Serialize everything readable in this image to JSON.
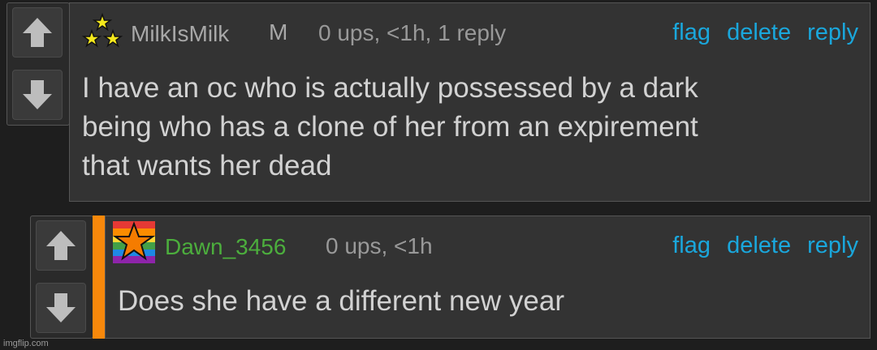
{
  "comments": [
    {
      "username": "MilkIsMilk",
      "tag": "M",
      "meta": "0 ups, <1h, 1 reply",
      "actions": {
        "flag": "flag",
        "delete": "delete",
        "reply": "reply"
      },
      "body_lines": [
        "I have an oc who is actually possessed by a dark",
        "being who has a clone of her from an expirement",
        "that wants her dead"
      ],
      "avatar_icon": "three-stars-icon"
    },
    {
      "username": "Dawn_3456",
      "meta": "0 ups, <1h",
      "actions": {
        "flag": "flag",
        "delete": "delete",
        "reply": "reply"
      },
      "body": "Does she have a different new year",
      "avatar_icon": "rainbow-star-icon",
      "username_color": "#4cae3d"
    }
  ],
  "colors": {
    "link": "#1aa7dc",
    "highlight_bar": "#f7880b",
    "background": "#1e1e1e",
    "panel": "#333333"
  },
  "watermark": "imgflip.com"
}
